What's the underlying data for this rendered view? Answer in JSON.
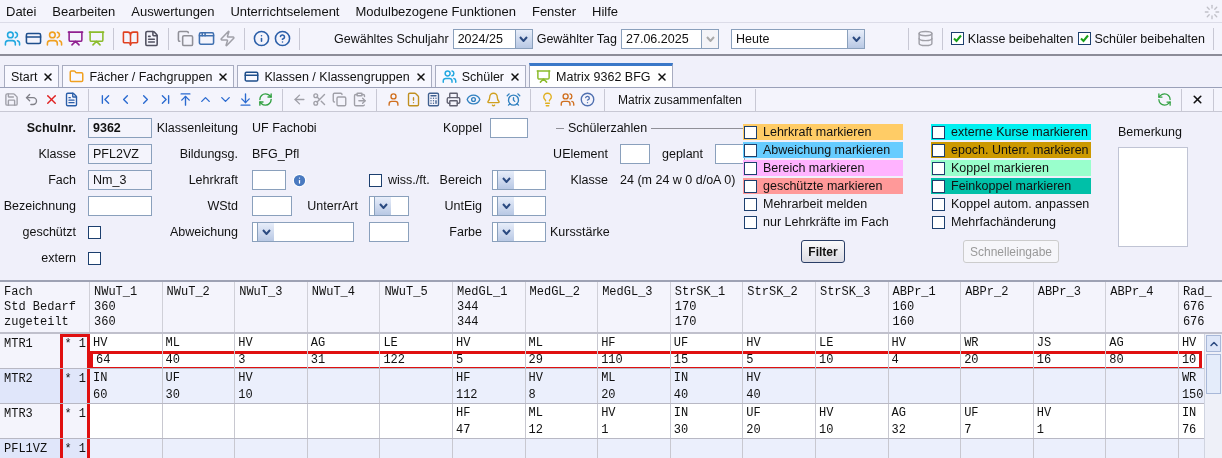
{
  "menu": [
    "Datei",
    "Bearbeiten",
    "Auswertungen",
    "Unterrichtselement",
    "Modulbezogene Funktionen",
    "Fenster",
    "Hilfe"
  ],
  "toolbar": {
    "schuljahr_label": "Gewähltes Schuljahr",
    "schuljahr": "2024/25",
    "tag_label": "Gewählter Tag",
    "tag": "27.06.2025",
    "tag_preset": "Heute",
    "checks": [
      {
        "label": "Klasse beibehalten",
        "checked": true
      },
      {
        "label": "Schüler beibehalten",
        "checked": true
      }
    ]
  },
  "tabs": [
    {
      "label": "Start",
      "selected": false
    },
    {
      "label": "Fächer / Fachgruppen",
      "selected": false
    },
    {
      "label": "Klassen / Klassengruppen",
      "selected": false
    },
    {
      "label": "Schüler",
      "selected": false
    },
    {
      "label": "Matrix 9362 BFG",
      "selected": true
    }
  ],
  "toolbar2": {
    "collapse_label": "Matrix zusammenfalten"
  },
  "form": {
    "schulnr": {
      "label": "Schulnr.",
      "value": "9362"
    },
    "klasse": {
      "label": "Klasse",
      "value": "PFL2VZ"
    },
    "fach": {
      "label": "Fach",
      "value": "Nm_3"
    },
    "bezeichnung": {
      "label": "Bezeichnung"
    },
    "geschuetzt": {
      "label": "geschützt",
      "checked": false
    },
    "extern": {
      "label": "extern",
      "checked": false
    },
    "klassenleitung": {
      "label": "Klassenleitung",
      "value": "UF Fachobi"
    },
    "bildungsgang": {
      "label": "Bildungsg.",
      "value": "BFG_Pfl"
    },
    "lehrkraft": {
      "label": "Lehrkraft"
    },
    "wstd": {
      "label": "WStd"
    },
    "abweichung": {
      "label": "Abweichung"
    },
    "unterrart": {
      "label": "UnterrArt"
    },
    "wiss": {
      "label": "wiss./ft.",
      "checked": false
    },
    "koppel": {
      "label": "Koppel"
    },
    "bereich": {
      "label": "Bereich"
    },
    "unteig": {
      "label": "UntEig"
    },
    "farbe": {
      "label": "Farbe"
    },
    "schuelerzahlen": {
      "title": "Schülerzahlen",
      "uelement_label": "UElement",
      "geplant_label": "geplant",
      "klasse_label": "Klasse",
      "klasse_value": "24 (m 24 w 0 d/oA 0)",
      "kursstaerke_label": "Kursstärke"
    },
    "marks_left": [
      {
        "label": "Lehrkraft markieren",
        "checked": false,
        "color": "#ffcc66"
      },
      {
        "label": "Abweichung markieren",
        "checked": false,
        "color": "#66ccff"
      },
      {
        "label": "Bereich markieren",
        "checked": false,
        "color": "#ffb3ff"
      },
      {
        "label": "geschützte markieren",
        "checked": false,
        "color": "#ff9999"
      },
      {
        "label": "Mehrarbeit melden",
        "checked": false
      },
      {
        "label": "nur Lehrkräfte im Fach",
        "checked": false
      }
    ],
    "marks_right": [
      {
        "label": "externe Kurse markieren",
        "checked": false,
        "color": "#00f0f0"
      },
      {
        "label": "epoch. Unterr. markieren",
        "checked": false,
        "color": "#cc9900"
      },
      {
        "label": "Koppel markieren",
        "checked": false,
        "color": "#99ffcc"
      },
      {
        "label": "Feinkoppel markieren",
        "checked": false,
        "color": "#00c0a8"
      },
      {
        "label": "Koppel autom. anpassen",
        "checked": false
      },
      {
        "label": "Mehrfachänderung",
        "checked": false
      }
    ],
    "filter": {
      "label": "Filter",
      "disabled": false
    },
    "schnelleingabe": {
      "label": "Schnelleingabe",
      "disabled": true
    },
    "bemerkung": {
      "label": "Bemerkung"
    }
  },
  "grid": {
    "header_labels": [
      "Fach",
      "Std Bedarf",
      "zugeteilt"
    ],
    "marker_column_highlighted": true,
    "columns": [
      {
        "name": "NWuT_1",
        "bedarf": "360",
        "zugeteilt": "360"
      },
      {
        "name": "NWuT_2"
      },
      {
        "name": "NWuT_3"
      },
      {
        "name": "NWuT_4"
      },
      {
        "name": "NWuT_5"
      },
      {
        "name": "MedGL_1",
        "bedarf": "344",
        "zugeteilt": "344"
      },
      {
        "name": "MedGL_2"
      },
      {
        "name": "MedGL_3"
      },
      {
        "name": "StrSK_1",
        "bedarf": "170",
        "zugeteilt": "170"
      },
      {
        "name": "StrSK_2"
      },
      {
        "name": "StrSK_3"
      },
      {
        "name": "ABPr_1",
        "bedarf": "160",
        "zugeteilt": "160"
      },
      {
        "name": "ABPr_2"
      },
      {
        "name": "ABPr_3"
      },
      {
        "name": "ABPr_4"
      },
      {
        "name": "Rad_",
        "bedarf": "676",
        "zugeteilt": "676"
      }
    ],
    "rows": [
      {
        "name": "MTR1",
        "marker": "* 1",
        "highlighted": true,
        "cells": [
          {
            "teacher": "HV",
            "hours": "64"
          },
          {
            "teacher": "ML",
            "hours": "40"
          },
          {
            "teacher": "HV",
            "hours": "3"
          },
          {
            "teacher": "AG",
            "hours": "31"
          },
          {
            "teacher": "LE",
            "hours": "122"
          },
          {
            "teacher": "HV",
            "hours": "5"
          },
          {
            "teacher": "ML",
            "hours": "29"
          },
          {
            "teacher": "HF",
            "hours": "110"
          },
          {
            "teacher": "UF",
            "hours": "15"
          },
          {
            "teacher": "HV",
            "hours": "5"
          },
          {
            "teacher": "LE",
            "hours": "10"
          },
          {
            "teacher": "HV",
            "hours": "4"
          },
          {
            "teacher": "WR",
            "hours": "20"
          },
          {
            "teacher": "JS",
            "hours": "16"
          },
          {
            "teacher": "AG",
            "hours": "80"
          },
          {
            "teacher": "HV",
            "hours": "10"
          }
        ]
      },
      {
        "name": "MTR2",
        "marker": "* 1",
        "highlighted": false,
        "cells": [
          {
            "teacher": "IN",
            "hours": "60"
          },
          {
            "teacher": "UF",
            "hours": "30"
          },
          {
            "teacher": "HV",
            "hours": "10"
          },
          null,
          null,
          {
            "teacher": "HF",
            "hours": "112"
          },
          {
            "teacher": "HV",
            "hours": "8"
          },
          {
            "teacher": "ML",
            "hours": "20"
          },
          {
            "teacher": "IN",
            "hours": "40"
          },
          {
            "teacher": "HV",
            "hours": "40"
          },
          null,
          null,
          null,
          null,
          null,
          {
            "teacher": "WR",
            "hours": "150"
          }
        ]
      },
      {
        "name": "MTR3",
        "marker": "* 1",
        "highlighted": false,
        "cells": [
          null,
          null,
          null,
          null,
          null,
          {
            "teacher": "HF",
            "hours": "47"
          },
          {
            "teacher": "ML",
            "hours": "12"
          },
          {
            "teacher": "HV",
            "hours": "1"
          },
          {
            "teacher": "IN",
            "hours": "30"
          },
          {
            "teacher": "UF",
            "hours": "20"
          },
          {
            "teacher": "HV",
            "hours": "10"
          },
          {
            "teacher": "AG",
            "hours": "32"
          },
          {
            "teacher": "UF",
            "hours": "7"
          },
          {
            "teacher": "HV",
            "hours": "1"
          },
          null,
          {
            "teacher": "IN",
            "hours": "76"
          }
        ]
      },
      {
        "name": "PFL1VZ",
        "marker": "* 1",
        "highlighted": false,
        "cells": [
          null,
          null,
          null,
          null,
          null,
          null,
          null,
          null,
          null,
          null,
          null,
          null,
          null,
          null,
          null,
          null
        ]
      }
    ]
  }
}
